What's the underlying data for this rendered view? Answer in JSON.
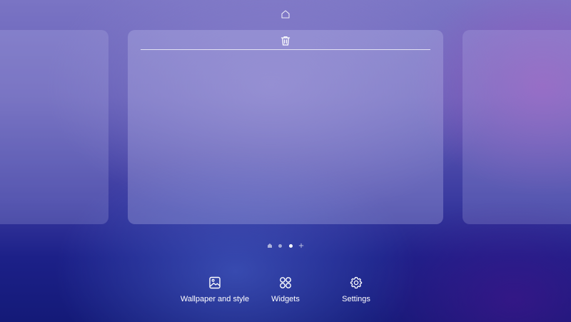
{
  "top": {
    "home_icon": "home-outline-icon"
  },
  "panels": {
    "center": {
      "delete_icon": "trash-icon"
    }
  },
  "page_indicator": {
    "items": [
      {
        "type": "home",
        "icon": "home-small-icon"
      },
      {
        "type": "dot"
      },
      {
        "type": "dot",
        "active": true
      },
      {
        "type": "add",
        "icon": "plus-icon"
      }
    ],
    "active_index": 2
  },
  "actions": {
    "wallpaper": {
      "label": "Wallpaper and style",
      "icon": "image-icon"
    },
    "widgets": {
      "label": "Widgets",
      "icon": "widgets-grid-icon"
    },
    "settings": {
      "label": "Settings",
      "icon": "gear-icon"
    }
  },
  "colors": {
    "background_top": "#7a74c4",
    "background_bottom": "#141a78",
    "text": "#ffffff"
  }
}
